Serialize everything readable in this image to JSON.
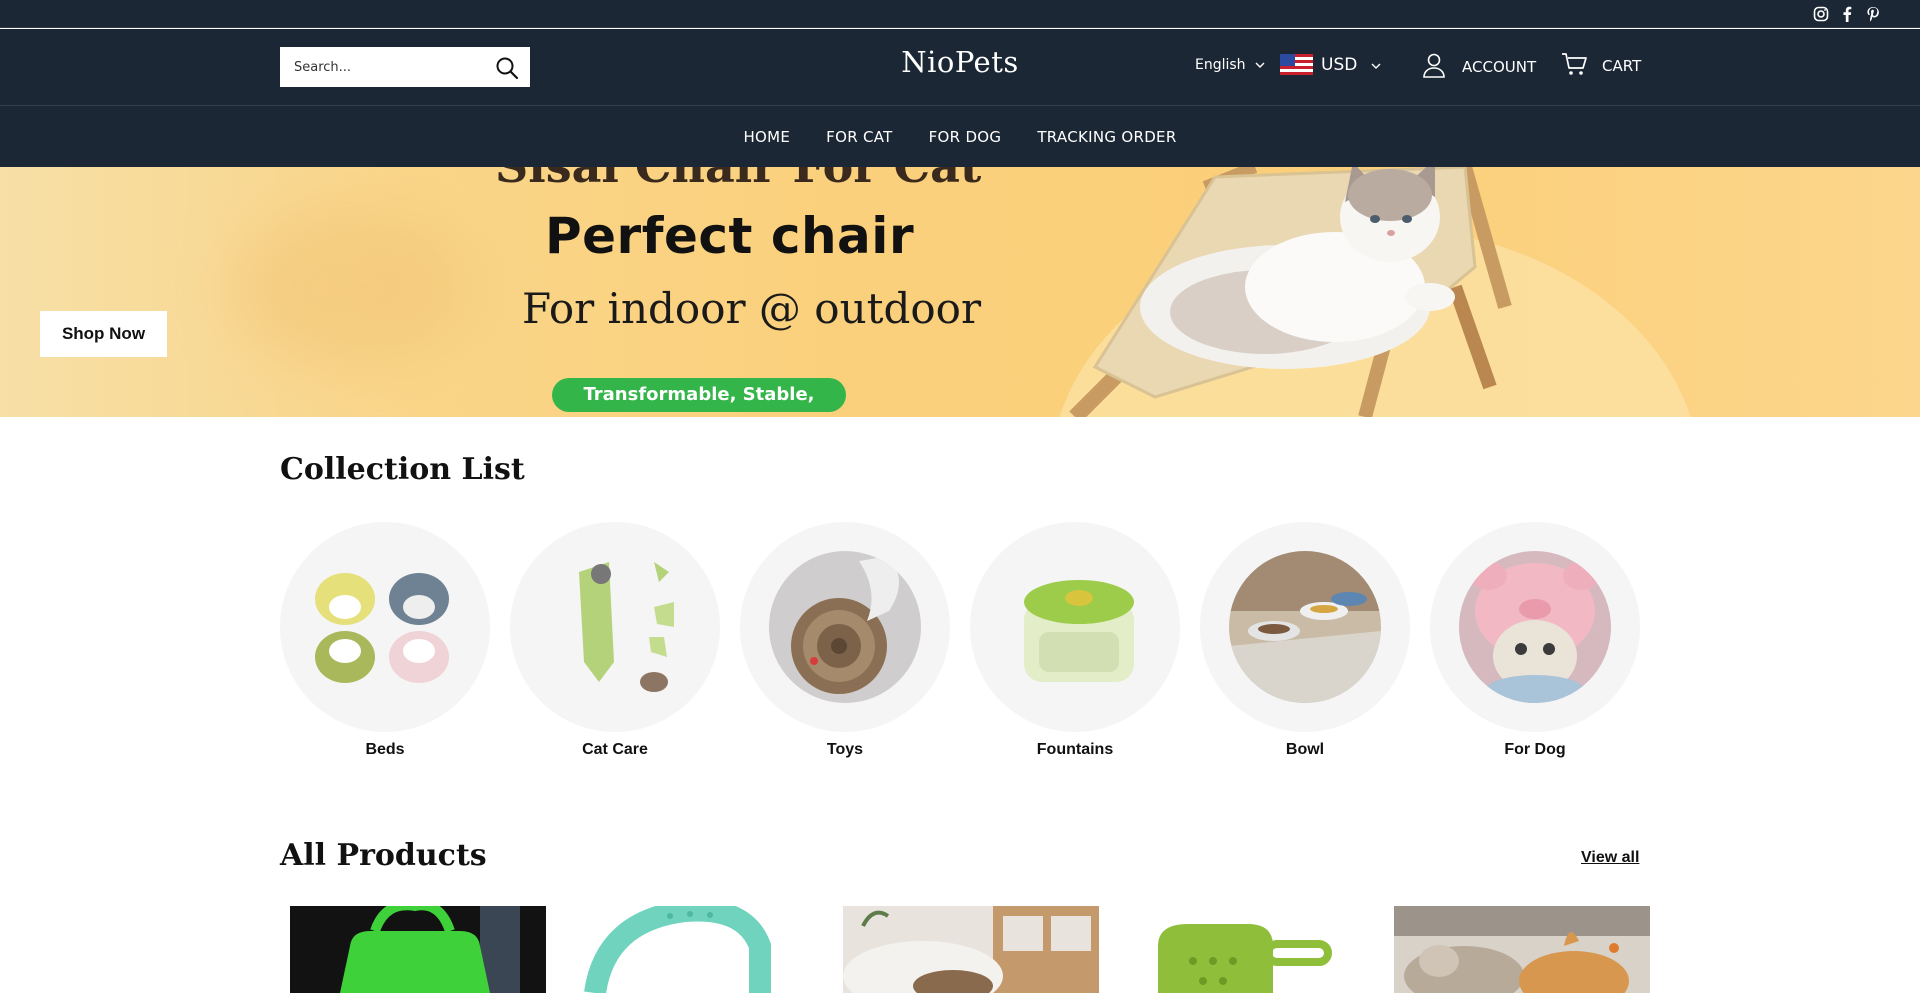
{
  "topbar": {
    "social_icons": [
      "instagram-icon",
      "facebook-icon",
      "pinterest-icon"
    ]
  },
  "header": {
    "search": {
      "placeholder": "Search..."
    },
    "logo": "NioPets",
    "language": "English",
    "currency": "USD",
    "account_label": "ACCOUNT",
    "cart_label": "CART"
  },
  "nav": {
    "items": [
      {
        "label": "HOME"
      },
      {
        "label": "FOR CAT"
      },
      {
        "label": "FOR DOG"
      },
      {
        "label": "TRACKING ORDER"
      }
    ]
  },
  "hero": {
    "title_partial": "Sisal Chair For Cat",
    "headline": "Perfect chair",
    "subline": "For indoor @ outdoor",
    "pill": "Transformable, Stable, Stylish",
    "button_label": "Shop Now"
  },
  "collection_list": {
    "title": "Collection List",
    "items": [
      {
        "label": "Beds"
      },
      {
        "label": "Cat Care"
      },
      {
        "label": "Toys"
      },
      {
        "label": "Fountains"
      },
      {
        "label": "Bowl"
      },
      {
        "label": "For Dog"
      }
    ]
  },
  "all_products": {
    "title": "All Products",
    "view_all_label": "View all"
  },
  "colors": {
    "header_bg": "#1c2735",
    "hero_bg": "#fbd07c",
    "pill_green": "#34b54a"
  }
}
